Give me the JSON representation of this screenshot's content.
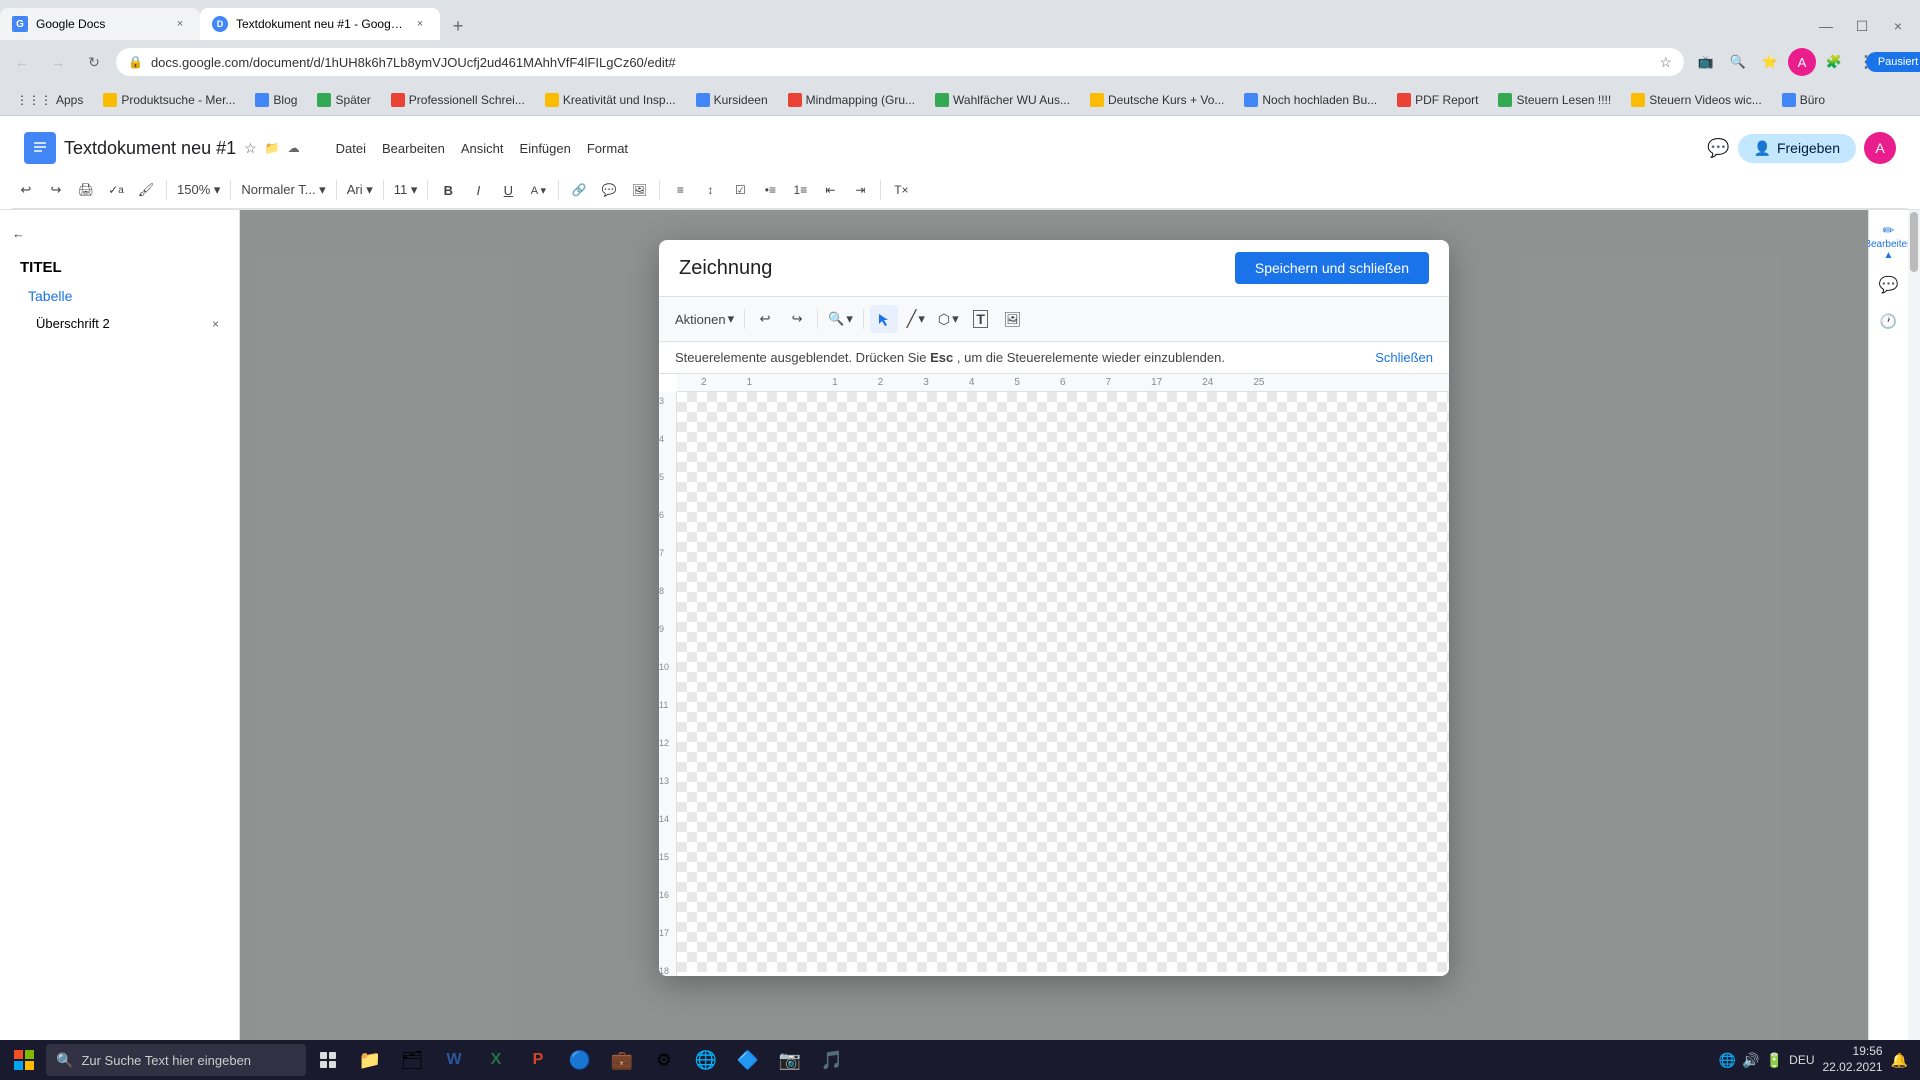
{
  "browser": {
    "tabs": [
      {
        "id": "tab1",
        "title": "Google Docs",
        "favicon": "G",
        "active": false
      },
      {
        "id": "tab2",
        "title": "Textdokument neu #1 - Google ...",
        "favicon": "D",
        "active": true
      }
    ],
    "url": "docs.google.com/document/d/1hUH8k6h7Lb8ymVJOUcfj2ud461MAhhVfF4lFILgCz60/edit#",
    "bookmarks": [
      {
        "label": "Apps"
      },
      {
        "label": "Produktsuche - Mer..."
      },
      {
        "label": "Blog"
      },
      {
        "label": "Später"
      },
      {
        "label": "Professionell Schrei..."
      },
      {
        "label": "Kreativität und Insp..."
      },
      {
        "label": "Kursideen"
      },
      {
        "label": "Mindmapping (Gru..."
      },
      {
        "label": "Wahlfächer WU Aus..."
      },
      {
        "label": "Deutsche Kurs + Vo..."
      },
      {
        "label": "Noch hochladen Bu..."
      },
      {
        "label": "PDF Report"
      },
      {
        "label": "Steuern Lesen !!!!"
      },
      {
        "label": "Steuern Videos wic..."
      },
      {
        "label": "Büro"
      }
    ]
  },
  "docs": {
    "title": "Textdokument neu #1",
    "menu": [
      "Datei",
      "Bearbeiten",
      "Ansicht",
      "Einfügen",
      "Format"
    ],
    "toolbar": {
      "undo": "↩",
      "redo": "↪",
      "print": "🖨",
      "spellcheck": "✓",
      "paint": "🖌",
      "zoom": "150%",
      "style": "Normaler T...",
      "font": "Ari"
    }
  },
  "sidebar": {
    "items": [
      {
        "label": "TITEL",
        "level": 1
      },
      {
        "label": "Tabelle",
        "level": 2
      },
      {
        "label": "Überschrift 2",
        "level": 3,
        "hasClose": true
      }
    ]
  },
  "drawing": {
    "title": "Zeichnung",
    "save_close_label": "Speichern und schließen",
    "actions_label": "Aktionen",
    "notification": {
      "text": "Steuerelemente ausgeblendet. Drücken Sie ",
      "key": "Esc",
      "text2": ", um die Steuerelemente wieder einzublenden.",
      "close_label": "Schließen"
    }
  },
  "header_right": {
    "edit_label": "Bearbeiten",
    "share_label": "Freigeben",
    "pause_label": "Pausiert",
    "avatar_initial": "A"
  },
  "taskbar": {
    "search_placeholder": "Zur Suche Text hier eingeben",
    "time": "19:56",
    "date": "22.02.2021",
    "language": "DEU"
  }
}
